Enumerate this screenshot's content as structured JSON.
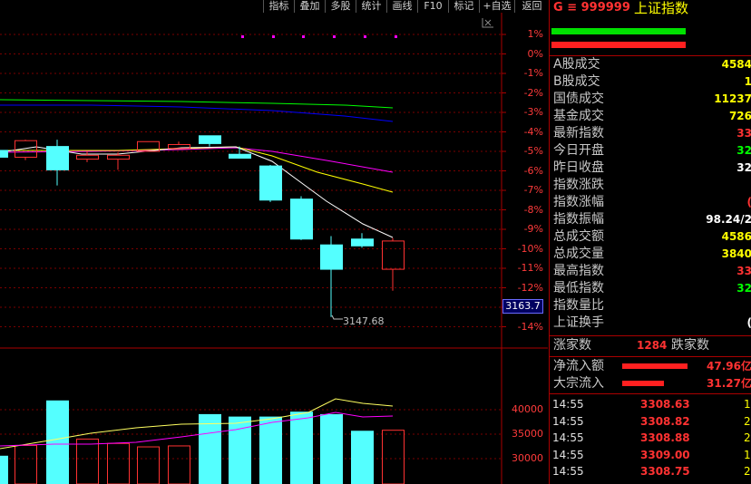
{
  "toolbar": {
    "buttons": [
      "指标",
      "叠加",
      "多股",
      "统计",
      "画线",
      "F10",
      "标记",
      "+自选",
      "返回"
    ]
  },
  "chart": {
    "pct_labels": [
      "1%",
      "0%",
      "-1%",
      "-2%",
      "-3%",
      "-4%",
      "-5%",
      "-6%",
      "-7%",
      "-8%",
      "-9%",
      "-10%",
      "-11%",
      "-12%",
      "-13%",
      "-14%"
    ],
    "current_price": "3163.7",
    "low_label": "3147.68",
    "vol_labels": [
      "40000",
      "35000",
      "30000"
    ]
  },
  "colors": {
    "up": "#ff3232",
    "down": "#54ffff",
    "ma5": "#ffffff",
    "ma10": "#ffff00",
    "ma20": "#ff00ff",
    "ma60": "#00ff00",
    "ma120": "#0000ff"
  },
  "panel": {
    "code": "G ≡ 999999",
    "name": "上证指数",
    "rows": [
      {
        "label": "A股成交",
        "value": "4584",
        "color": "#ffff00"
      },
      {
        "label": "B股成交",
        "value": "1",
        "color": "#ffff00"
      },
      {
        "label": "国债成交",
        "value": "11237",
        "color": "#ffff00"
      },
      {
        "label": "基金成交",
        "value": "726",
        "color": "#ffff00"
      },
      {
        "label": "最新指数",
        "value": "33",
        "color": "#ff3232"
      },
      {
        "label": "今日开盘",
        "value": "32",
        "color": "#00ff00"
      },
      {
        "label": "昨日收盘",
        "value": "32",
        "color": "#ffffff"
      },
      {
        "label": "指数涨跌",
        "value": "",
        "color": "#ff3232"
      },
      {
        "label": "指数涨幅",
        "value": "(",
        "color": "#ff3232"
      },
      {
        "label": "指数振幅",
        "value": "98.24/2",
        "color": "#ffffff"
      },
      {
        "label": "总成交额",
        "value": "4586",
        "color": "#ffff00"
      },
      {
        "label": "总成交量",
        "value": "3840",
        "color": "#ffff00"
      },
      {
        "label": "最高指数",
        "value": "33",
        "color": "#ff3232"
      },
      {
        "label": "最低指数",
        "value": "32",
        "color": "#00ff00"
      },
      {
        "label": "指数量比",
        "value": "",
        "color": "#ffffff"
      },
      {
        "label": "上证换手",
        "value": "(",
        "color": "#ffffff"
      }
    ],
    "rise_label": "涨家数",
    "rise_count": "1284",
    "fall_label": "跌家数",
    "net_inflow_label": "净流入额",
    "net_inflow_value": "47.96亿",
    "block_inflow_label": "大宗流入",
    "block_inflow_value": "31.27亿",
    "ticks": [
      {
        "time": "14:55",
        "price": "3308.63",
        "vol": "1"
      },
      {
        "time": "14:55",
        "price": "3308.82",
        "vol": "2"
      },
      {
        "time": "14:55",
        "price": "3308.88",
        "vol": "2"
      },
      {
        "time": "14:55",
        "price": "3309.00",
        "vol": "1"
      },
      {
        "time": "14:55",
        "price": "3308.75",
        "vol": "2"
      }
    ]
  },
  "candles": [
    {
      "o": -4.95,
      "c": -5.3,
      "h": -4.8,
      "l": -5.4
    },
    {
      "o": -5.3,
      "c": -4.45,
      "h": -4.4,
      "l": -5.45
    },
    {
      "o": -4.75,
      "c": -5.95,
      "h": -4.4,
      "l": -6.75
    },
    {
      "o": -5.4,
      "c": -5.2,
      "h": -5.0,
      "l": -5.55
    },
    {
      "o": -5.4,
      "c": -5.2,
      "h": -5.05,
      "l": -5.95
    },
    {
      "o": -5.0,
      "c": -4.5,
      "h": -4.5,
      "l": -5.0
    },
    {
      "o": -4.85,
      "c": -4.65,
      "h": -4.5,
      "l": -4.85
    },
    {
      "o": -4.2,
      "c": -4.6,
      "h": -4.2,
      "l": -4.75
    },
    {
      "o": -5.15,
      "c": -5.35,
      "h": -4.75,
      "l": -5.35
    },
    {
      "o": -5.75,
      "c": -7.5,
      "h": -5.7,
      "l": -7.6
    },
    {
      "o": -7.45,
      "c": -9.5,
      "h": -7.3,
      "l": -9.55
    },
    {
      "o": -9.8,
      "c": -11.05,
      "h": -9.35,
      "l": -13.5
    },
    {
      "o": -9.5,
      "c": -9.85,
      "h": -9.2,
      "l": -9.95
    },
    {
      "o": -11.05,
      "c": -9.6,
      "h": -9.45,
      "l": -12.15
    }
  ],
  "volumes": [
    30500,
    32700,
    41800,
    34000,
    33100,
    32400,
    32600,
    39000,
    38500,
    38500,
    39500,
    39000,
    35600,
    35800
  ]
}
